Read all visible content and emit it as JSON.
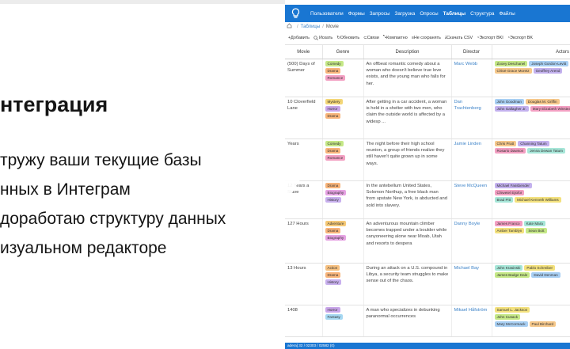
{
  "slide": {
    "title": "нтеграция",
    "lines": [
      "тружу ваши текущие базы",
      "нных в Интеграм",
      "доработаю структуру данных",
      "изуальном редакторе"
    ]
  },
  "app": {
    "menu": [
      "Пользователи",
      "Формы",
      "Запросы",
      "Загрузка",
      "Опросы",
      "Таблицы",
      "Структура",
      "Файлы"
    ],
    "active_menu": "Таблицы",
    "breadcrumb": [
      "Таблицы",
      "Movie"
    ],
    "toolbar": [
      "Добавить",
      "Искать",
      "Обновить",
      "Связи",
      "Компактно",
      "Не сохранять",
      "Скачать CSV",
      "Экспорт BKI",
      "Экспорт BK"
    ],
    "columns": [
      "Movie",
      "Genre",
      "Description",
      "Director",
      "Actors"
    ],
    "rows": [
      {
        "movie": "(500) Days of Summer",
        "genres": [
          "Comedy",
          "Drama",
          "Romance"
        ],
        "description": "An offbeat romantic comedy about a woman who doesn't believe true love exists, and the young man who falls for her.",
        "director": "Marc Webb",
        "actors": [
          "Zooey Deschanel",
          "Joseph Gordon-Levitt",
          "Chloë Grace Moretz",
          "Geoffrey Arend"
        ]
      },
      {
        "movie": "10 Cloverfield Lane",
        "genres": [
          "Mystery",
          "Horror",
          "Drama"
        ],
        "description": "After getting in a car accident, a woman is held in a shelter with two men, who claim the outside world is affected by a widesp ...",
        "director": "Dan Trachtenberg",
        "actors": [
          "John Goodman",
          "Douglas M. Griffin",
          "John Gallagher Jr.",
          "Mary Elizabeth Winstead"
        ]
      },
      {
        "movie": "Years",
        "genres": [
          "Comedy",
          "Drama",
          "Romance"
        ],
        "description": "The night before their high school reunion, a group of friends realize they still haven't quite grown up in some ways.",
        "director": "Jamie Linden",
        "actors": [
          "Chris Pratt",
          "Channing Tatum",
          "Rosario Dawson",
          "Jenna Dewan Tatum"
        ]
      },
      {
        "movie": "12 Years a Slave",
        "genres": [
          "Drama",
          "Biography",
          "History"
        ],
        "description": "In the antebellum United States, Solomon Northup, a free black man from upstate New York, is abducted and sold into slavery.",
        "director": "Steve McQueen",
        "actors": [
          "Michael Fassbender",
          "Chiwetel Ejiofor",
          "Brad Pitt",
          "Michael Kenneth Williams"
        ]
      },
      {
        "movie": "127 Hours",
        "genres": [
          "Adventure",
          "Drama",
          "Biography"
        ],
        "description": "An adventurous mountain climber becomes trapped under a boulder while canyoneering alone near Moab, Utah and resorts to despera",
        "director": "Danny Boyle",
        "actors": [
          "James Franco",
          "Kate Mara",
          "Amber Tamblyn",
          "Sean Bott"
        ]
      },
      {
        "movie": "13 Hours",
        "genres": [
          "Action",
          "Drama",
          "History"
        ],
        "description": "During an attack on a U.S. compound in Libya, a security team struggles to make sense out of the chaos.",
        "director": "Michael Bay",
        "actors": [
          "John Krasinski",
          "Pablo Schreiber",
          "James Badge Dale",
          "David Denman"
        ]
      },
      {
        "movie": "1408",
        "genres": [
          "Horror",
          "Fantasy"
        ],
        "description": "A man who specializes in debunking paranormal occurrences",
        "director": "Mikael Håfström",
        "actors": [
          "Samuel L. Jackson",
          "John Cusack",
          "Mary McCormack",
          "Paul Birchard"
        ]
      }
    ],
    "status": "adera] 32 / 02303 / 02582 (0)"
  },
  "tag_colors": {
    "Comedy": "#c5e887",
    "Drama": "#f8b47a",
    "Romance": "#f39fc2",
    "Mystery": "#f3d677",
    "Horror": "#c9a6ea",
    "Biography": "#e6a2e3",
    "History": "#c8b0ee",
    "Adventure": "#f5c977",
    "Action": "#f6c080",
    "Fantasy": "#a6d8f2"
  },
  "actor_colors": [
    "#c5e887",
    "#a8cff3",
    "#f6c88b",
    "#c3b1ee",
    "#f39fc2",
    "#a6e6d8",
    "#f3e17d"
  ]
}
